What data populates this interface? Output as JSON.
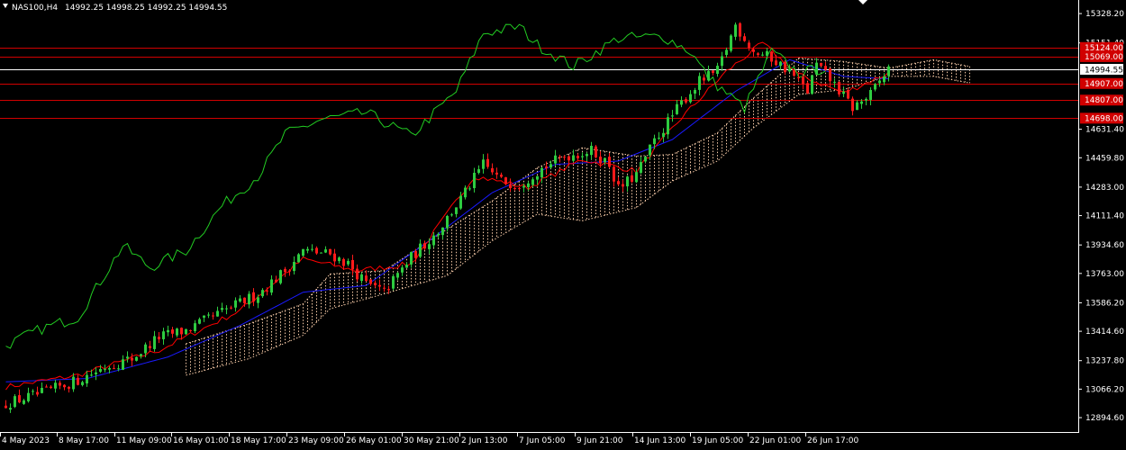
{
  "chart_header": {
    "symbol_timeframe": "NAS100,H4",
    "ohlc": "14992.25 14998.25 14992.25 14994.55"
  },
  "colors": {
    "background": "#000000",
    "bull_candle": "#2ECC40",
    "bear_candle": "#FF1A1A",
    "tenkan": "#FF0000",
    "kijun": "#1A1AFF",
    "chikou": "#22CC22",
    "cloud": "#F5C9A6",
    "level_line": "#D10000",
    "current_price_line": "#FFFFFF",
    "axis": "#FFFFFF"
  },
  "chart_data": {
    "type": "candlestick",
    "title": "",
    "instrument": "NAS100",
    "timeframe": "H4",
    "ylim": [
      12808,
      15410
    ],
    "y_ticks": [
      "15328.20",
      "15151.40",
      "14631.40",
      "14459.80",
      "14283.00",
      "14111.40",
      "13934.60",
      "13763.00",
      "13586.20",
      "13414.60",
      "13237.80",
      "13066.20",
      "12894.60"
    ],
    "x_ticks": [
      "4 May 2023",
      "8 May 17:00",
      "11 May 09:00",
      "16 May 01:00",
      "18 May 17:00",
      "23 May 09:00",
      "26 May 01:00",
      "30 May 21:00",
      "2 Jun 13:00",
      "7 Jun 05:00",
      "9 Jun 21:00",
      "14 Jun 13:00",
      "19 Jun 05:00",
      "22 Jun 01:00",
      "26 Jun 17:00"
    ],
    "current_price": {
      "value": 14994.55,
      "label": "14994.55"
    },
    "levels": [
      {
        "value": 15124.0,
        "label": "15124.00"
      },
      {
        "value": 15069.0,
        "label": "15069.00"
      },
      {
        "value": 14907.0,
        "label": "14907.00"
      },
      {
        "value": 14807.0,
        "label": "14807.00"
      },
      {
        "value": 14698.0,
        "label": "14698.00"
      }
    ],
    "indicator": "Ichimoku Kinko Hyo",
    "close_path": [
      [
        0,
        12980
      ],
      [
        8,
        13040
      ],
      [
        16,
        13120
      ],
      [
        22,
        13200
      ],
      [
        28,
        13250
      ],
      [
        34,
        13380
      ],
      [
        40,
        13420
      ],
      [
        48,
        13530
      ],
      [
        56,
        13640
      ],
      [
        62,
        13780
      ],
      [
        66,
        13900
      ],
      [
        72,
        13880
      ],
      [
        76,
        13820
      ],
      [
        80,
        13700
      ],
      [
        84,
        13650
      ],
      [
        90,
        13860
      ],
      [
        96,
        14020
      ],
      [
        102,
        14250
      ],
      [
        106,
        14420
      ],
      [
        110,
        14320
      ],
      [
        114,
        14300
      ],
      [
        118,
        14380
      ],
      [
        124,
        14470
      ],
      [
        130,
        14500
      ],
      [
        134,
        14420
      ],
      [
        136,
        14270
      ],
      [
        140,
        14360
      ],
      [
        144,
        14560
      ],
      [
        150,
        14790
      ],
      [
        154,
        14920
      ],
      [
        158,
        14980
      ],
      [
        162,
        15260
      ],
      [
        166,
        15100
      ],
      [
        170,
        15060
      ],
      [
        174,
        14980
      ],
      [
        178,
        14860
      ],
      [
        180,
        15020
      ],
      [
        184,
        14900
      ],
      [
        188,
        14760
      ],
      [
        192,
        14840
      ],
      [
        196,
        14995
      ]
    ],
    "tenkan_path": [
      [
        0,
        13080
      ],
      [
        16,
        13150
      ],
      [
        34,
        13300
      ],
      [
        52,
        13540
      ],
      [
        66,
        13850
      ],
      [
        78,
        13780
      ],
      [
        90,
        13820
      ],
      [
        104,
        14350
      ],
      [
        116,
        14280
      ],
      [
        128,
        14450
      ],
      [
        140,
        14380
      ],
      [
        150,
        14700
      ],
      [
        160,
        14980
      ],
      [
        168,
        15150
      ],
      [
        176,
        14960
      ],
      [
        186,
        14850
      ],
      [
        196,
        14970
      ]
    ],
    "kijun_path": [
      [
        0,
        13110
      ],
      [
        18,
        13130
      ],
      [
        36,
        13260
      ],
      [
        52,
        13450
      ],
      [
        66,
        13650
      ],
      [
        80,
        13690
      ],
      [
        94,
        13960
      ],
      [
        108,
        14250
      ],
      [
        122,
        14420
      ],
      [
        136,
        14440
      ],
      [
        148,
        14570
      ],
      [
        162,
        14860
      ],
      [
        174,
        15050
      ],
      [
        186,
        14950
      ],
      [
        196,
        14935
      ]
    ],
    "chikou_path": [
      [
        0,
        13330
      ],
      [
        8,
        13430
      ],
      [
        16,
        13500
      ],
      [
        26,
        13930
      ],
      [
        32,
        13800
      ],
      [
        40,
        13900
      ],
      [
        48,
        14170
      ],
      [
        56,
        14350
      ],
      [
        62,
        14600
      ],
      [
        70,
        14690
      ],
      [
        80,
        14730
      ],
      [
        90,
        14590
      ],
      [
        100,
        14860
      ],
      [
        106,
        15210
      ],
      [
        114,
        15250
      ],
      [
        118,
        15140
      ],
      [
        126,
        15010
      ],
      [
        136,
        15180
      ],
      [
        146,
        15190
      ],
      [
        152,
        15100
      ],
      [
        156,
        14940
      ],
      [
        164,
        14760
      ],
      [
        170,
        15100
      ],
      [
        176,
        14970
      ],
      [
        182,
        15000
      ]
    ],
    "cloud_path": [
      [
        40,
        13150,
        13340
      ],
      [
        54,
        13250,
        13460
      ],
      [
        66,
        13390,
        13580
      ],
      [
        72,
        13550,
        13760
      ],
      [
        84,
        13640,
        13780
      ],
      [
        98,
        13750,
        14030
      ],
      [
        108,
        13960,
        14200
      ],
      [
        118,
        14120,
        14400
      ],
      [
        128,
        14080,
        14520
      ],
      [
        140,
        14160,
        14470
      ],
      [
        148,
        14320,
        14480
      ],
      [
        158,
        14440,
        14610
      ],
      [
        166,
        14640,
        14820
      ],
      [
        176,
        14840,
        15060
      ],
      [
        186,
        14870,
        15040
      ],
      [
        196,
        14950,
        15000
      ],
      [
        206,
        14950,
        15050
      ],
      [
        214,
        14910,
        15010
      ]
    ]
  }
}
